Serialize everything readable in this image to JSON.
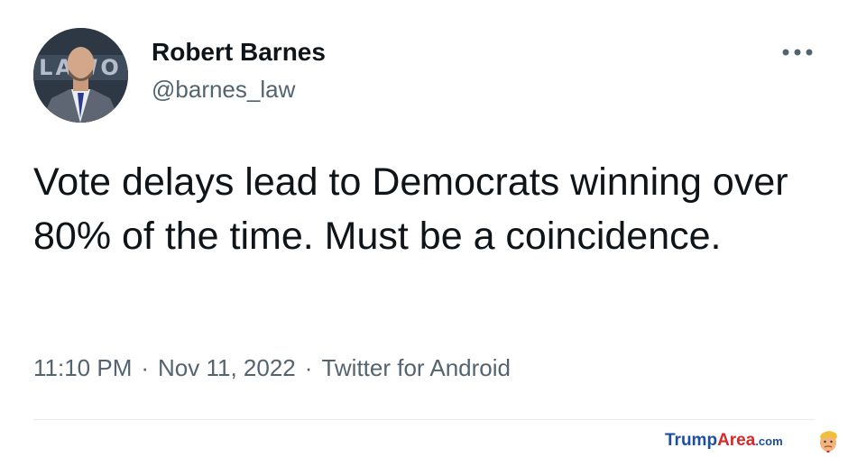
{
  "tweet": {
    "author": {
      "display_name": "Robert Barnes",
      "handle": "@barnes_law",
      "avatar_backdrop_text": "LAWO"
    },
    "more_options_icon": "more-horizontal-icon",
    "text": "Vote delays lead to Democrats winning over 80% of the time. Must be a coincidence.",
    "time": "11:10 PM",
    "separator": "·",
    "date": "Nov 11, 2022",
    "source": "Twitter for Android"
  },
  "watermark": {
    "part1": "Trump",
    "part2": "Area",
    "part3": ".com",
    "icon": "trump-face-icon"
  },
  "colors": {
    "text_primary": "#0f1419",
    "text_secondary": "#536471",
    "divider": "#e6ecf0",
    "watermark_blue": "#1b4fa0",
    "watermark_red": "#d62a2a"
  }
}
